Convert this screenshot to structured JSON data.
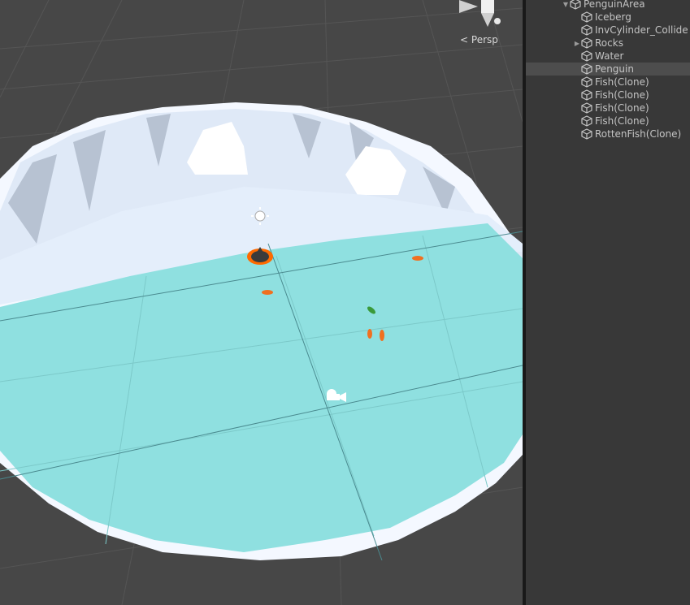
{
  "scene_view": {
    "projection_label": "Persp",
    "colors": {
      "grid_bg": "#474747",
      "water": "#8fe0e0",
      "ice": "#e8f2ff",
      "penguin_outline": "#ff6a00"
    }
  },
  "hierarchy": {
    "root": {
      "label": "PenguinArea",
      "expanded": true
    },
    "items": [
      {
        "label": "Iceberg",
        "expandable": false,
        "selected": false
      },
      {
        "label": "InvCylinder_Collide",
        "expandable": false,
        "selected": false
      },
      {
        "label": "Rocks",
        "expandable": true,
        "selected": false
      },
      {
        "label": "Water",
        "expandable": false,
        "selected": false
      },
      {
        "label": "Penguin",
        "expandable": false,
        "selected": true
      },
      {
        "label": "Fish(Clone)",
        "expandable": false,
        "selected": false
      },
      {
        "label": "Fish(Clone)",
        "expandable": false,
        "selected": false
      },
      {
        "label": "Fish(Clone)",
        "expandable": false,
        "selected": false
      },
      {
        "label": "Fish(Clone)",
        "expandable": false,
        "selected": false
      },
      {
        "label": "RottenFish(Clone)",
        "expandable": false,
        "selected": false
      }
    ]
  }
}
